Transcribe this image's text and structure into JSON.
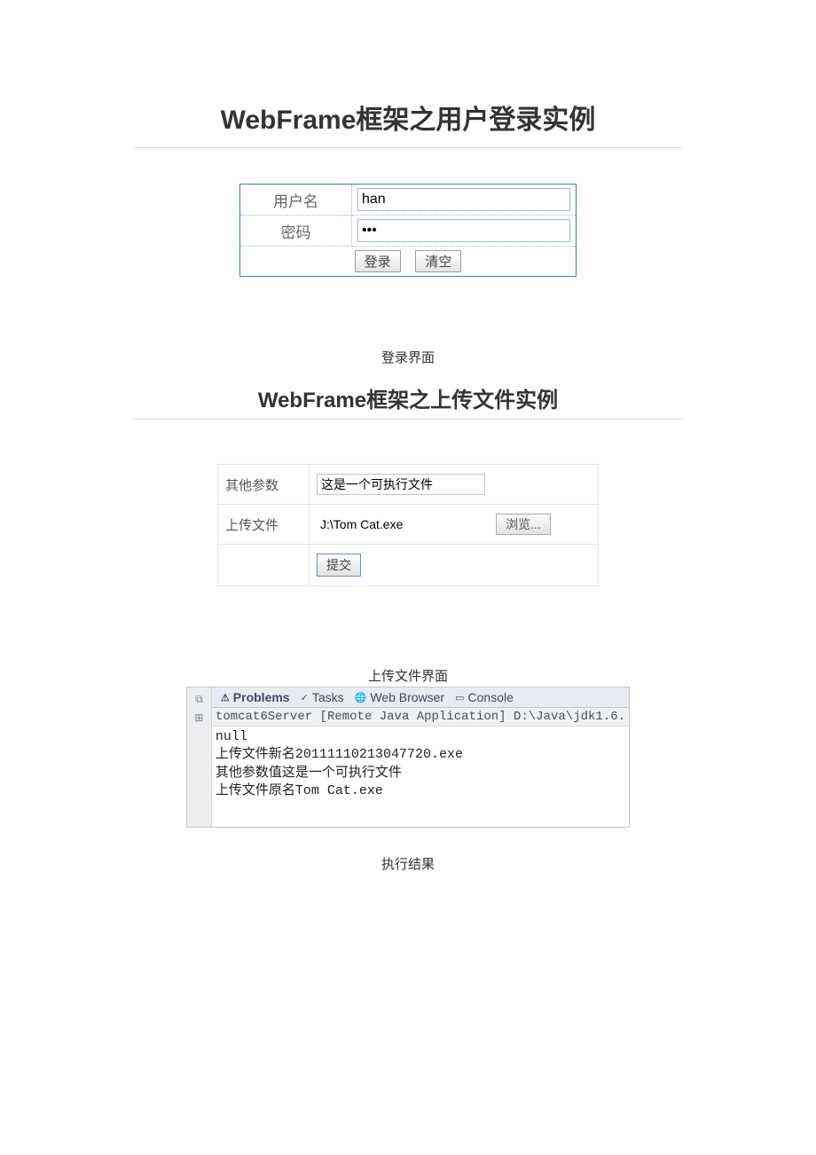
{
  "section1": {
    "title": "WebFrame框架之用户登录实例",
    "form": {
      "username_label": "用户名",
      "username_value": "han",
      "password_label": "密码",
      "password_value": "•••",
      "login_btn": "登录",
      "clear_btn": "清空"
    },
    "caption": "登录界面"
  },
  "section2": {
    "title": "WebFrame框架之上传文件实例",
    "form": {
      "param_label": "其他参数",
      "param_value": "这是一个可执行文件",
      "file_label": "上传文件",
      "file_path": "J:\\Tom Cat.exe",
      "browse_btn": "浏览...",
      "submit_btn": "提交"
    },
    "caption": "上传文件界面"
  },
  "console": {
    "tabs": {
      "problems": "Problems",
      "tasks": "Tasks",
      "webbrowser": "Web Browser",
      "console": "Console"
    },
    "header": "tomcat6Server [Remote Java Application] D:\\Java\\jdk1.6.",
    "output": "null\n上传文件新名20111110213047720.exe\n其他参数值这是一个可执行文件\n上传文件原名Tom Cat.exe",
    "caption": "执行结果"
  }
}
